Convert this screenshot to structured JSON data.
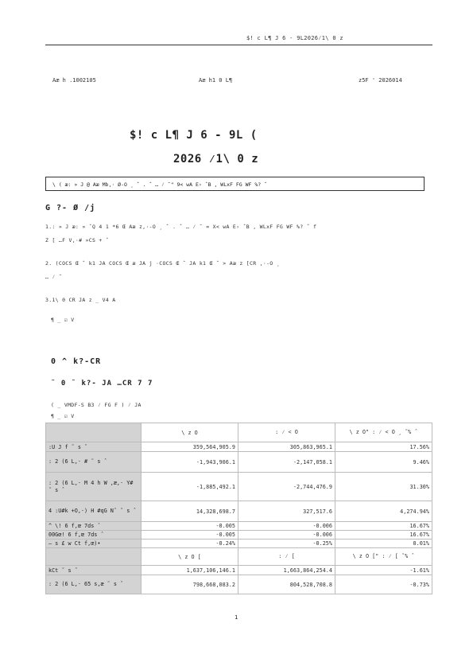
{
  "header": {
    "running_title": "$! c  L¶        J    6  - 9L2026⁄1\\ 0          z"
  },
  "meta": {
    "left": "Aæ h  .1002105",
    "center": "Aæ h1 0    L¶",
    "right": "z5F ' 2026014"
  },
  "title": {
    "line1": "$! c  L¶        J    6  - 9L     (",
    "line2": "2026 ⁄1\\ 0          z"
  },
  "notice_box": "\\   ( æ:  » J      @    Aæ       Mb,·   Ø-O ¸  ˆ  .  ˆ … ⁄ ˜\"   9<  wA E› ˆB  , WLxF  FG   WF %? ˆ",
  "section1": {
    "heading": "G ?-    Ø  /j",
    "item1_line1": "1.:  » J æ:  » ˆQ 4 1 *6 Œ     Aæ         z,·-O ¸  ˆ  .  ˆ … ⁄ ˜ =    X<  wA E› ˆB  , WLxF  FG   WF %? ˆ f",
    "item1_line2": " Z [ …F  V,·#  »CS + ˆ",
    "item2_line1": "2.  (COCS Œ ˆ k1  JA      COCS Œ æ JA  j ·COCS Œ ˆ JA  k1  Œ    ˆ   >     Aæ         z [CR      ,·-O ¸",
    "item2_line2": " … ⁄ ˜",
    "item3": "3.1\\ 0     CR    JA     z _ V4    A",
    "check_row": "¶ _ ☑ V"
  },
  "section2": {
    "heading": "0  ^ k?-CR",
    "subheading": "˜ 0  ˜ k?- JA       …CR   7 7",
    "note": "( _ VMDF-S B3 ⁄ FG F     ) ⁄    JA",
    "check_row": "¶ _ ☑ V"
  },
  "table": {
    "header1": [
      "",
      "\\   z O",
      ": ⁄ < O",
      "\\   z O\"  : ⁄ < O ¸ ˜% ˆ"
    ],
    "rows1": [
      {
        "label": ":U J f   ˜ s ˆ",
        "a": "359,564,905.9",
        "b": "305,863,965.1",
        "c": "17.56%"
      },
      {
        "label": "       : 2    (6  L,· #  ˜ s ˆ",
        "a": "-1,943,906.1",
        "b": "-2,147,058.1",
        "c": "9.46%"
      },
      {
        "label": "       : 2    (6  L,· M 4  h W  ,æ,·   Y# ˜ s ˆ",
        "a": "-1,885,492.1",
        "b": "-2,744,476.9",
        "c": "31.30%"
      },
      {
        "label": "4 :U#k      +O,·) H #qG N˜ ˜ s ˆ",
        "a": "14,328,698.7",
        "b": "327,517.6",
        "c": "4,274.94%"
      },
      {
        "label": " ^ \\! 6  f,œ 7ds ˆ",
        "a": "-0.005",
        "b": "-0.006",
        "c": "16.67%"
      },
      {
        "label": "00Gœ! 6  f,œ 7ds ˆ",
        "a": "-0.005",
        "b": "-0.006",
        "c": "16.67%"
      },
      {
        "label": " — s £ w  Ct   f,œ)•",
        "a": "-0.24%",
        "b": "-0.25%",
        "c": "0.01%"
      }
    ],
    "header2": [
      "",
      "\\   z O [",
      ": ⁄    [",
      "\\   z O [\"  : ⁄   [ ˜% ˆ"
    ],
    "rows2": [
      {
        "label": " kCt    ˜ s ˆ",
        "a": "1,637,106,146.1",
        "b": "1,663,864,254.4",
        "c": "-1.61%"
      },
      {
        "label": "       : 2    (6  L,· 65 s,æ ˜ s ˆ",
        "a": "798,668,083.2",
        "b": "804,528,708.8",
        "c": "-0.73%"
      }
    ]
  },
  "footer": {
    "page_number": "1"
  }
}
